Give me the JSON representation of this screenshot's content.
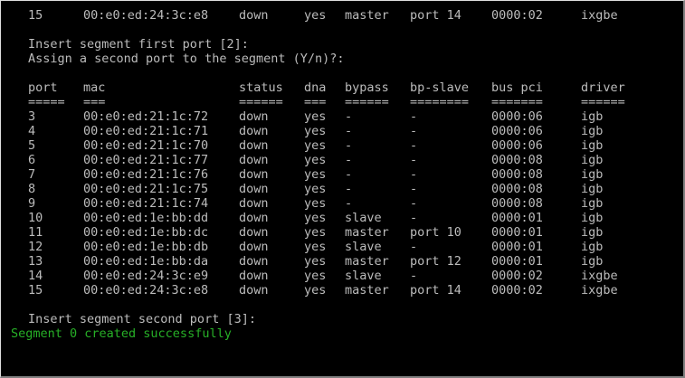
{
  "terminal": {
    "top_row": {
      "port": "15",
      "mac": "00:e0:ed:24:3c:e8",
      "status": "down",
      "dna": "yes",
      "bypass": "master",
      "bp_slave": "port 14",
      "bus_pci": "0000:02",
      "driver": "ixgbe"
    },
    "prompt_first_port": "Insert segment first port [2]:",
    "prompt_second_assign": "Assign a second port to the segment (Y/n)?:",
    "headers": {
      "port": "port",
      "mac": "mac",
      "status": "status",
      "dna": "dna",
      "bypass": "bypass",
      "bp_slave": "bp-slave",
      "bus_pci": "bus pci",
      "driver": "driver"
    },
    "underlines": {
      "port": "=====",
      "mac": "===",
      "status": "======",
      "dna": "===",
      "bypass": "======",
      "bp_slave": "========",
      "bus_pci": "=======",
      "driver": "======"
    },
    "rows": [
      {
        "port": "3",
        "mac": "00:e0:ed:21:1c:72",
        "status": "down",
        "dna": "yes",
        "bypass": "-",
        "bp_slave": "-",
        "bus_pci": "0000:06",
        "driver": "igb"
      },
      {
        "port": "4",
        "mac": "00:e0:ed:21:1c:71",
        "status": "down",
        "dna": "yes",
        "bypass": "-",
        "bp_slave": "-",
        "bus_pci": "0000:06",
        "driver": "igb"
      },
      {
        "port": "5",
        "mac": "00:e0:ed:21:1c:70",
        "status": "down",
        "dna": "yes",
        "bypass": "-",
        "bp_slave": "-",
        "bus_pci": "0000:06",
        "driver": "igb"
      },
      {
        "port": "6",
        "mac": "00:e0:ed:21:1c:77",
        "status": "down",
        "dna": "yes",
        "bypass": "-",
        "bp_slave": "-",
        "bus_pci": "0000:08",
        "driver": "igb"
      },
      {
        "port": "7",
        "mac": "00:e0:ed:21:1c:76",
        "status": "down",
        "dna": "yes",
        "bypass": "-",
        "bp_slave": "-",
        "bus_pci": "0000:08",
        "driver": "igb"
      },
      {
        "port": "8",
        "mac": "00:e0:ed:21:1c:75",
        "status": "down",
        "dna": "yes",
        "bypass": "-",
        "bp_slave": "-",
        "bus_pci": "0000:08",
        "driver": "igb"
      },
      {
        "port": "9",
        "mac": "00:e0:ed:21:1c:74",
        "status": "down",
        "dna": "yes",
        "bypass": "-",
        "bp_slave": "-",
        "bus_pci": "0000:08",
        "driver": "igb"
      },
      {
        "port": "10",
        "mac": "00:e0:ed:1e:bb:dd",
        "status": "down",
        "dna": "yes",
        "bypass": "slave",
        "bp_slave": "-",
        "bus_pci": "0000:01",
        "driver": "igb"
      },
      {
        "port": "11",
        "mac": "00:e0:ed:1e:bb:dc",
        "status": "down",
        "dna": "yes",
        "bypass": "master",
        "bp_slave": "port 10",
        "bus_pci": "0000:01",
        "driver": "igb"
      },
      {
        "port": "12",
        "mac": "00:e0:ed:1e:bb:db",
        "status": "down",
        "dna": "yes",
        "bypass": "slave",
        "bp_slave": "-",
        "bus_pci": "0000:01",
        "driver": "igb"
      },
      {
        "port": "13",
        "mac": "00:e0:ed:1e:bb:da",
        "status": "down",
        "dna": "yes",
        "bypass": "master",
        "bp_slave": "port 12",
        "bus_pci": "0000:01",
        "driver": "igb"
      },
      {
        "port": "14",
        "mac": "00:e0:ed:24:3c:e9",
        "status": "down",
        "dna": "yes",
        "bypass": "slave",
        "bp_slave": "-",
        "bus_pci": "0000:02",
        "driver": "ixgbe"
      },
      {
        "port": "15",
        "mac": "00:e0:ed:24:3c:e8",
        "status": "down",
        "dna": "yes",
        "bypass": "master",
        "bp_slave": "port 14",
        "bus_pci": "0000:02",
        "driver": "ixgbe"
      }
    ],
    "prompt_second_port": "Insert segment second port [3]:",
    "success_message": "Segment 0 created successfully"
  },
  "colors": {
    "background": "#000000",
    "text": "#bcbcbc",
    "success": "#27b027"
  }
}
